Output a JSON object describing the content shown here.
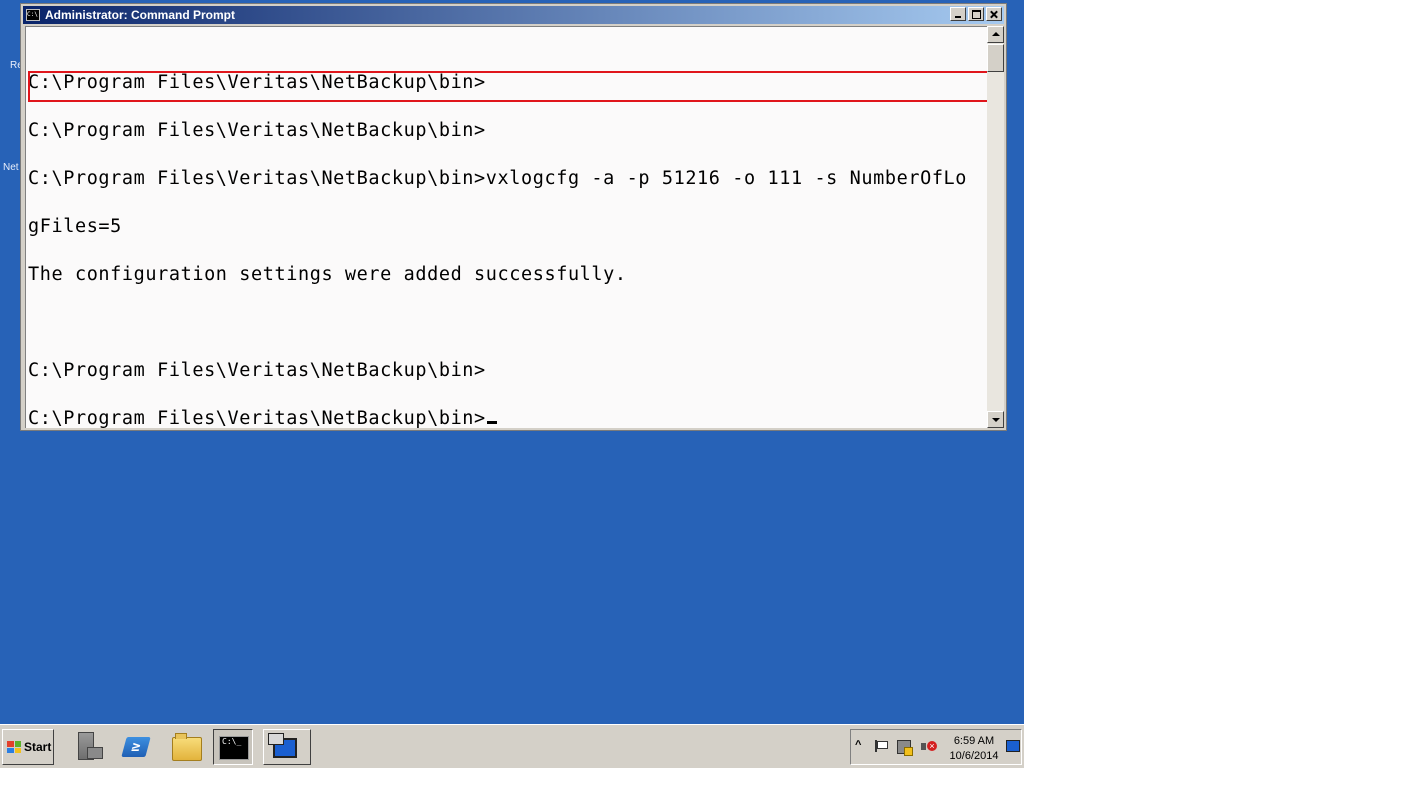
{
  "window": {
    "title": "Administrator: Command Prompt",
    "icon": "cmd-window-icon",
    "icon_glyph": "C:\\"
  },
  "console": {
    "lines": [
      "C:\\Program Files\\Veritas\\NetBackup\\bin>",
      "C:\\Program Files\\Veritas\\NetBackup\\bin>",
      "C:\\Program Files\\Veritas\\NetBackup\\bin>vxlogcfg -a -p 51216 -o 111 -s NumberOfLo",
      "gFiles=5",
      "The configuration settings were added successfully.",
      "",
      "C:\\Program Files\\Veritas\\NetBackup\\bin>",
      "C:\\Program Files\\Veritas\\NetBackup\\bin>"
    ],
    "highlight_color": "#e0161c"
  },
  "desktop": {
    "background": "#2762b7",
    "fragments": [
      "Re",
      "Net"
    ]
  },
  "taskbar": {
    "start_label": "Start",
    "apps": [
      {
        "name": "server-manager-icon"
      },
      {
        "name": "powershell-icon",
        "glyph": "≥"
      },
      {
        "name": "windows-explorer-icon"
      },
      {
        "name": "command-prompt-icon",
        "glyph": "C:\\_",
        "active": true
      },
      {
        "name": "remote-desktop-icon"
      }
    ],
    "tray": {
      "time": "6:59 AM",
      "date": "10/6/2014",
      "chevron": "^"
    }
  }
}
